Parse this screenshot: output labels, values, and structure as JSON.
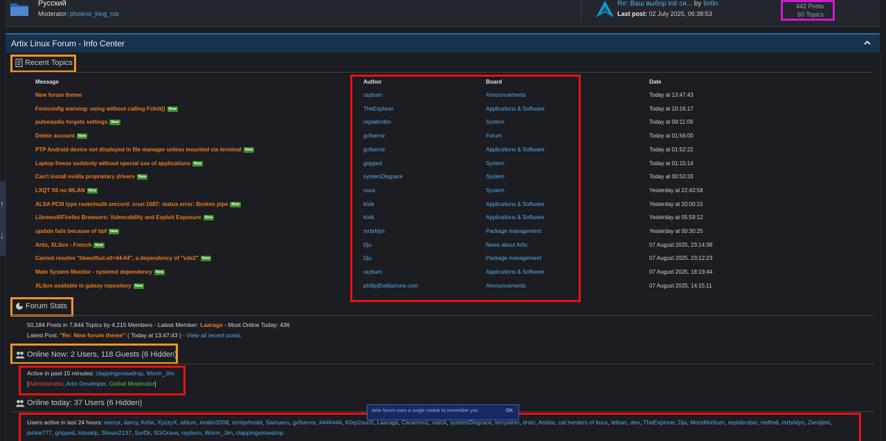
{
  "board": {
    "name": "Русский",
    "moderator_label": "Moderator:",
    "moderator": "phoenix_king_rus",
    "last_post_title": "Re: Ваш выбор init си...",
    "last_post_by_label": "by",
    "last_post_author": "tintin",
    "last_post_label": "Last post:",
    "last_post_date": "02 July 2025, 06:38:53",
    "posts": "442 Posts",
    "topics": "60 Topics"
  },
  "info_center": {
    "title": "Artix Linux Forum - Info Center",
    "recent_topics_title": "Recent Topics",
    "columns": {
      "message": "Message",
      "author": "Author",
      "board": "Board",
      "date": "Date"
    },
    "new_badge": "New",
    "topics": [
      {
        "message": "New forum theme",
        "new": false,
        "author": "rayburn",
        "board": "Announcements",
        "date": "Today at 13:47:43"
      },
      {
        "message": "Fontconfig warning: using without calling FcInit()",
        "new": true,
        "author": "TheExplorer",
        "board": "Applications & Software",
        "date": "Today at 10:16:17"
      },
      {
        "message": "pulseaudio forgets settings",
        "new": true,
        "author": "replabrobin",
        "board": "System",
        "date": "Today at 09:11:09"
      },
      {
        "message": "Delete account",
        "new": true,
        "author": "gvfserror",
        "board": "Forum",
        "date": "Today at 01:56:00"
      },
      {
        "message": "PTP Android device not displayed in file manager unless mounted via terminal",
        "new": true,
        "author": "gvfserror",
        "board": "Applications & Software",
        "date": "Today at 01:52:22"
      },
      {
        "message": "Laptop freeze suddenly without special use of applications",
        "new": true,
        "author": "gripped",
        "board": "System",
        "date": "Today at 01:15:14"
      },
      {
        "message": "Can't install nvidia proprietary drivers",
        "new": true,
        "author": "systemDisgrace",
        "board": "System",
        "date": "Today at 00:53:33"
      },
      {
        "message": "LXQT S6 no WLAN",
        "new": true,
        "author": "nous",
        "board": "System",
        "date": "Yesterday at 22:42:58"
      },
      {
        "message": "ALSA PCM type route/multi arecord: xrun:1687: status error: Broken pipe",
        "new": true,
        "author": "kixik",
        "board": "Applications & Software",
        "date": "Yesterday at 20:00:15"
      },
      {
        "message": "Librewolf/Firefox Browsers: Vulnerability and Exploit Exposure",
        "new": true,
        "author": "kixik",
        "board": "Applications & Software",
        "date": "Yesterday at 05:59:12"
      },
      {
        "message": "update fails because of bpf",
        "new": true,
        "author": "mrbrklyn",
        "board": "Package management",
        "date": "Yesterday at 00:30:25"
      },
      {
        "message": "Artix, XLibre - French",
        "new": true,
        "author": "Dju",
        "board": "News about Artix",
        "date": "07 August 2025, 23:14:38"
      },
      {
        "message": "Cannot resolve \"libwolfssl.s0=44-64\", a dependency of \"vde2\"",
        "new": true,
        "author": "Dju",
        "board": "Package management",
        "date": "07 August 2025, 23:12:23"
      },
      {
        "message": "Mate System Monitor - systemd dependency",
        "new": true,
        "author": "rayburn",
        "board": "Applications & Software",
        "date": "07 August 2025, 18:19:44"
      },
      {
        "message": "XLibre available in galaxy repository",
        "new": true,
        "author": "philip@wittamore.com",
        "board": "Announcements",
        "date": "07 August 2025, 14:15:11"
      }
    ],
    "forum_stats_title": "Forum Stats",
    "stats_line1_a": "50,184 Posts in 7,844 Topics by 4,215 Members - Latest Member: ",
    "latest_member": "Laarags",
    "stats_line1_b": " - Most Online Today: 436",
    "latest_post_label": "Latest Post: ",
    "latest_post_title": "\"Re: New forum theme\"",
    "latest_post_time": " ( Today at 13:47:43 ) - ",
    "view_all": "View all recent posts.",
    "online_now_title": "Online Now: 2 Users, 118 Guests (6 Hidden)",
    "active_15_label": "Active in past 15 minutes: ",
    "active_15_users": [
      "clappingsnowdrop",
      "Worm_Jim"
    ],
    "roles": [
      "Administrator",
      "Artix Developer",
      "Global Moderator"
    ],
    "online_today_title": "Online today: 37 Users (6 Hidden)",
    "active_24_label": "Users active in last 24 hours: ",
    "active_24_users": [
      "wiezyr",
      "darcy",
      "Artist",
      "XyzzyX",
      "aldum",
      "mobin2008",
      "ncmprhnsbl",
      "Samueru",
      "gvfserror",
      "#######",
      "K0rp2ouch",
      "Laarags",
      "Caramonz",
      "vialck",
      "systemDisgrace",
      "terryatnin",
      "tintin",
      "Ambie",
      "cat herders of linux",
      "letkan",
      "den",
      "TheExplorer",
      "Dju",
      "MorsMortium",
      "replabrobin",
      "redfrell",
      "mrbrklyn",
      "Zendjinn",
      "jackie777",
      "gripped",
      "lotuskip",
      "Shoun2137",
      "Surf3r",
      "SGOrava",
      "rayburn",
      "Worm_Jim",
      "clappingsnowdrop"
    ]
  },
  "cookie_notice": {
    "text": "Artix forum uses a single cookie to remember you",
    "ok": "OK"
  },
  "colors": {
    "accent": "#f07c1c",
    "link": "#5aa9e6",
    "admin": "#e0504a",
    "dev": "#5aa9e6",
    "globalmod": "#5fbf4a"
  }
}
